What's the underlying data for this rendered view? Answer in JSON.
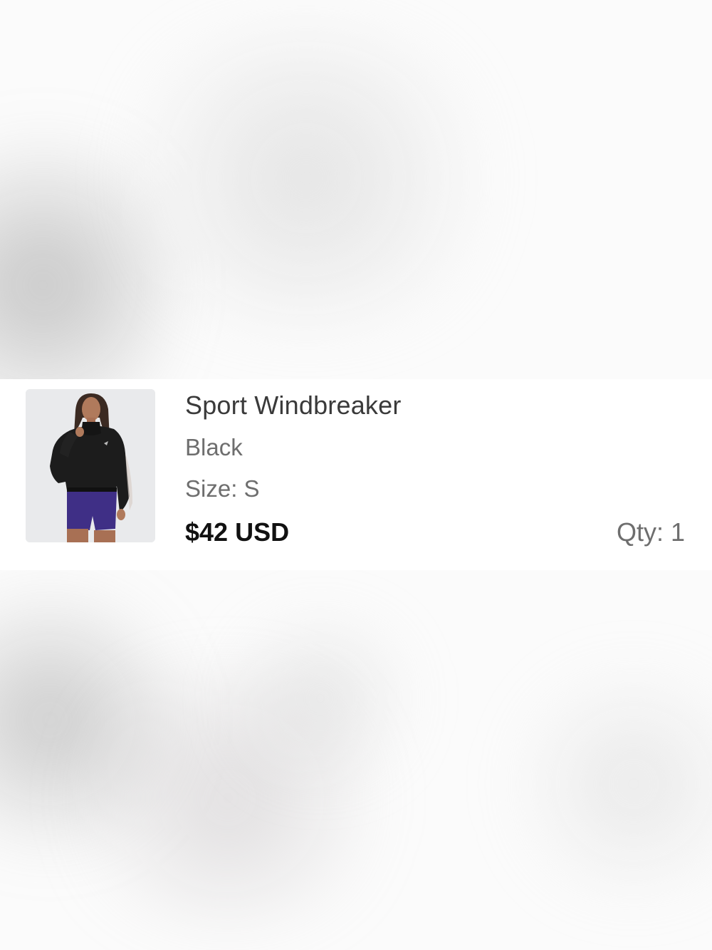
{
  "cart_item": {
    "title": "Sport Windbreaker",
    "color": "Black",
    "size": "Size: S",
    "price": "$42 USD",
    "quantity": "Qty: 1",
    "image_icon": "product-photo-windbreaker"
  },
  "colors": {
    "card_background": "#ffffff",
    "title_text": "#3a3a3a",
    "secondary_text": "#6e6e6e",
    "price_text": "#111111",
    "thumbnail_background": "#e9eaec",
    "jacket": "#1c1c1c",
    "shorts": "#3f2f86"
  }
}
